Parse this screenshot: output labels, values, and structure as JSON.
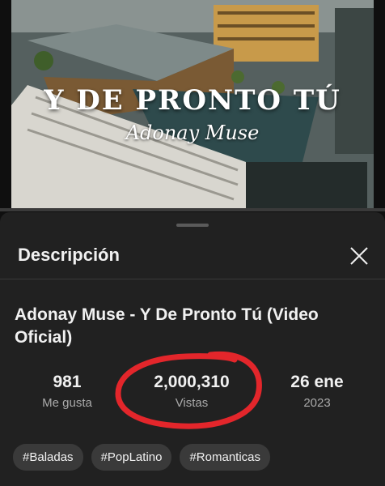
{
  "video": {
    "overlay_title": "Y DE PRONTO TÚ",
    "overlay_artist": "Adonay Muse"
  },
  "sheet": {
    "header": "Descripción",
    "close_icon": "close-icon",
    "video_title": "Adonay Muse - Y De Pronto Tú (Video Oficial)",
    "stats": {
      "likes": {
        "value": "981",
        "label": "Me gusta"
      },
      "views": {
        "value": "2,000,310",
        "label": "Vistas"
      },
      "date": {
        "value": "26 ene",
        "label": "2023"
      }
    },
    "tags": [
      "#Baladas",
      "#PopLatino",
      "#Romanticas"
    ]
  },
  "colors": {
    "background": "#0f0f0f",
    "sheet": "#212121",
    "chip": "#3a3a3a",
    "highlight": "#e3262b"
  }
}
